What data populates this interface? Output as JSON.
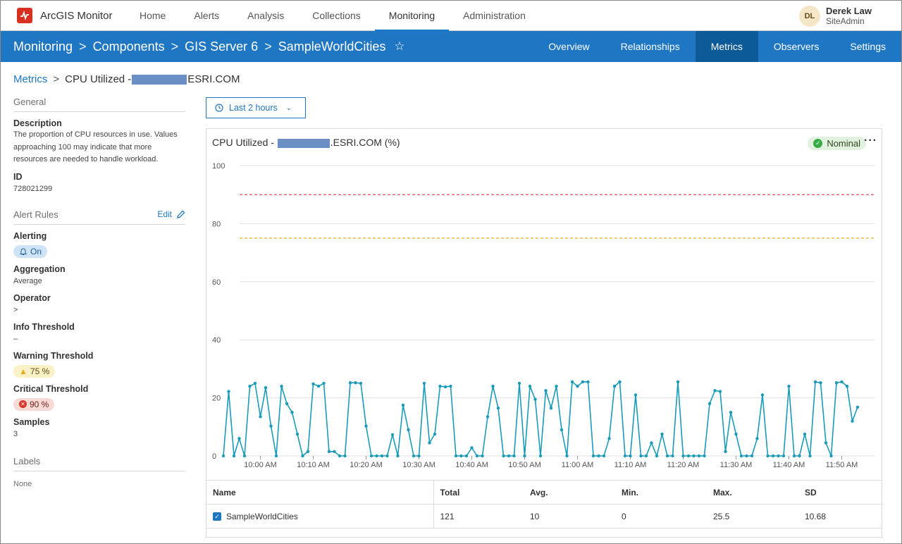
{
  "app": {
    "name": "ArcGIS Monitor"
  },
  "topnav": [
    {
      "label": "Home",
      "active": false
    },
    {
      "label": "Alerts",
      "active": false
    },
    {
      "label": "Analysis",
      "active": false
    },
    {
      "label": "Collections",
      "active": false
    },
    {
      "label": "Monitoring",
      "active": true
    },
    {
      "label": "Administration",
      "active": false
    }
  ],
  "user": {
    "initials": "DL",
    "name": "Derek Law",
    "role": "SiteAdmin"
  },
  "header": {
    "crumbs": [
      "Monitoring",
      "Components",
      "GIS Server 6",
      "SampleWorldCities"
    ],
    "tabs": [
      {
        "label": "Overview",
        "active": false
      },
      {
        "label": "Relationships",
        "active": false
      },
      {
        "label": "Metrics",
        "active": true
      },
      {
        "label": "Observers",
        "active": false
      },
      {
        "label": "Settings",
        "active": false
      }
    ]
  },
  "page_crumb": {
    "parent": "Metrics",
    "prefix": "CPU Utilized - ",
    "suffix": "ESRI.COM"
  },
  "sidebar": {
    "general_title": "General",
    "description_label": "Description",
    "description": "The proportion of CPU resources in use. Values approaching 100 may indicate that more resources are needed to handle workload.",
    "id_label": "ID",
    "id": "728021299",
    "alert_rules_title": "Alert Rules",
    "edit_label": "Edit",
    "alerting_label": "Alerting",
    "alerting_value": "On",
    "aggregation_label": "Aggregation",
    "aggregation_value": "Average",
    "operator_label": "Operator",
    "operator_value": ">",
    "info_label": "Info Threshold",
    "info_value": "–",
    "warning_label": "Warning Threshold",
    "warning_value": "75 %",
    "critical_label": "Critical Threshold",
    "critical_value": "90 %",
    "samples_label": "Samples",
    "samples_value": "3",
    "labels_title": "Labels",
    "labels_value": "None"
  },
  "time_range": "Last 2 hours",
  "chart_header": {
    "prefix": "CPU Utilized - ",
    "suffix": ".ESRI.COM (%)",
    "status": "Nominal"
  },
  "colors": {
    "line": "#1a9bb8",
    "critical": "#e0393e",
    "warning": "#e3ad1c",
    "accent": "#1f77c4"
  },
  "chart_data": {
    "type": "line",
    "title": "CPU Utilized - .ESRI.COM (%)",
    "ylim": [
      0,
      100
    ],
    "yticks": [
      0,
      20,
      40,
      60,
      80,
      100
    ],
    "x_start": "09:53",
    "x_step_minutes": 1,
    "xtick_labels": [
      "10:00 AM",
      "10:10 AM",
      "10:20 AM",
      "10:30 AM",
      "10:40 AM",
      "10:50 AM",
      "11:00 AM",
      "11:10 AM",
      "11:20 AM",
      "11:30 AM",
      "11:40 AM",
      "11:50 AM"
    ],
    "thresholds": [
      {
        "name": "Critical",
        "value": 90
      },
      {
        "name": "Warning",
        "value": 75
      }
    ],
    "series": [
      {
        "name": "SampleWorldCities",
        "values": [
          0,
          22.2,
          0,
          6,
          0,
          24,
          25,
          13.5,
          23.5,
          10.3,
          0,
          24,
          18,
          15,
          7.5,
          0,
          1.5,
          24.8,
          24,
          25,
          1.5,
          1.5,
          0,
          0,
          25.2,
          25.2,
          25,
          10.3,
          0,
          0,
          0,
          0,
          7.3,
          0,
          17.5,
          9,
          0,
          0,
          25,
          4.5,
          7.5,
          24,
          23.8,
          24,
          0,
          0,
          0,
          2.8,
          0,
          0,
          13.5,
          24,
          16.5,
          0,
          0,
          0,
          25,
          0,
          24,
          19.5,
          0,
          22.5,
          16.5,
          24,
          9,
          0,
          25.5,
          24,
          25.5,
          25.5,
          0,
          0,
          0,
          6,
          24,
          25.5,
          0,
          0,
          21,
          0,
          0,
          4.5,
          0,
          7.5,
          0,
          0,
          25.5,
          0,
          0,
          0,
          0,
          0,
          18,
          22.5,
          22.2,
          1.5,
          15,
          7.5,
          0,
          0,
          0,
          6,
          21,
          0,
          0,
          0,
          0,
          24,
          0,
          0,
          7.5,
          0,
          25.5,
          25.2,
          4.5,
          0,
          25.2,
          25.5,
          24,
          12,
          16.8
        ]
      }
    ]
  },
  "table": {
    "headers": [
      "Name",
      "Total",
      "Avg.",
      "Min.",
      "Max.",
      "SD"
    ],
    "rows": [
      {
        "name": "SampleWorldCities",
        "total": "121",
        "avg": "10",
        "min": "0",
        "max": "25.5",
        "sd": "10.68"
      }
    ]
  }
}
